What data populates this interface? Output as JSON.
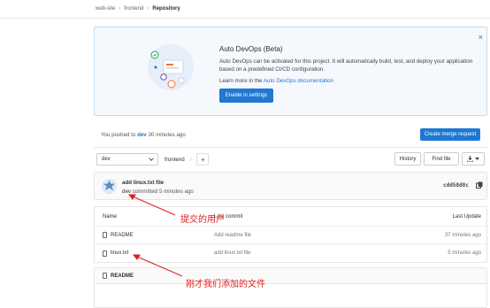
{
  "breadcrumb": {
    "group": "web-site",
    "project": "frontend",
    "current": "Repository"
  },
  "devops": {
    "title": "Auto DevOps (Beta)",
    "description": "Auto DevOps can be activated for this project. It will automatically build, test, and deploy your application based on a predefined CI/CD configuration.",
    "learn_prefix": "Learn more in the",
    "learn_link": "Auto DevOps documentation",
    "enable_button": "Enable in settings",
    "close": "×"
  },
  "push_notice": {
    "prefix": "You pushed to",
    "branch": "dev",
    "suffix": "30 minutes ago",
    "merge_button": "Create merge request"
  },
  "toolbar": {
    "branch": "dev",
    "path": "frontend",
    "separator": "/",
    "add": "+",
    "history": "History",
    "find_file": "Find file"
  },
  "last_commit": {
    "message": "add linux.txt file",
    "author": "dev",
    "time": "committed 5 minutes ago",
    "sha": "cdd58d8c"
  },
  "file_table": {
    "headers": {
      "name": "Name",
      "commit": "Last commit",
      "update": "Last Update"
    },
    "rows": [
      {
        "name": "README",
        "commit": "Add readme file",
        "update": "37 minutes ago"
      },
      {
        "name": "linux.txt",
        "commit": "add linux.txt file",
        "update": "5 minutes ago"
      }
    ]
  },
  "readme": {
    "title": "README"
  },
  "annotations": {
    "submitter": "提交的用户",
    "added_file": "刚才我们添加的文件"
  },
  "colors": {
    "primary": "#1f78d1",
    "annotation": "#e02020"
  }
}
